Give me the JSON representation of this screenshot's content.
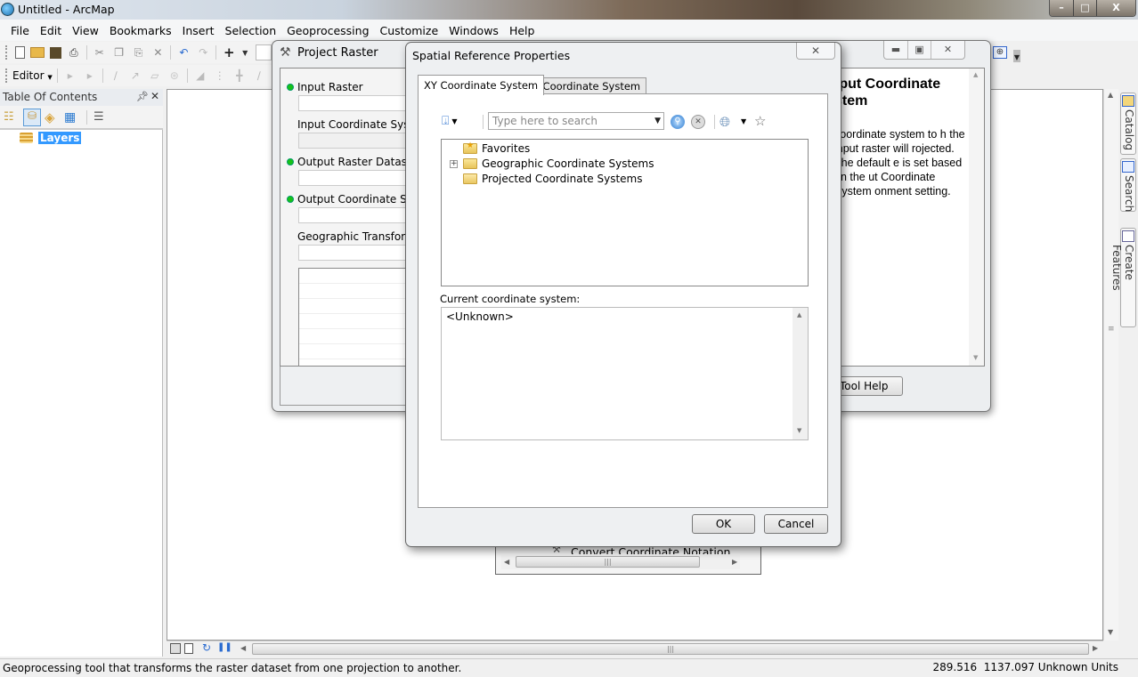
{
  "window": {
    "title": "Untitled - ArcMap",
    "controls": {
      "minimize": "–",
      "maximize": "□",
      "close": "X"
    }
  },
  "menubar": {
    "items": [
      "File",
      "Edit",
      "View",
      "Bookmarks",
      "Insert",
      "Selection",
      "Geoprocessing",
      "Customize",
      "Windows",
      "Help"
    ]
  },
  "toolbar": {
    "editor_label": "Editor"
  },
  "toc": {
    "title": "Table Of Contents",
    "pin": "⌂",
    "close": "✕",
    "root_layer": "Layers"
  },
  "right_dock": {
    "tabs": [
      "Catalog",
      "Search",
      "Create Features"
    ]
  },
  "status_bar": {
    "message": "Geoprocessing tool that transforms the raster dataset from one projection to another.",
    "coordinates": "289.516  1137.097 Unknown Units"
  },
  "project_raster": {
    "title": "Project Raster",
    "params": [
      {
        "label": "Input Raster",
        "required": true,
        "value": ""
      },
      {
        "label": "Input Coordinate System",
        "required": false,
        "value": ""
      },
      {
        "label": "Output Raster Dataset",
        "required": true,
        "value": ""
      },
      {
        "label": "Output Coordinate System",
        "required": true,
        "value": ""
      },
      {
        "label": "Geographic Transformation",
        "required": false,
        "value": ""
      }
    ],
    "help": {
      "title": "Output Coordinate System",
      "title_visible": "tput Coordinate stem",
      "body_visible": "coordinate system to h the input raster will rojected. The default e is set based on the ut Coordinate System onment setting."
    },
    "tool_help_button": "Tool Help"
  },
  "convert_window": {
    "item": "Convert Coordinate Notation"
  },
  "spatial_ref": {
    "title": "Spatial Reference Properties",
    "close": "X",
    "tabs": [
      {
        "label": "XY Coordinate System",
        "active": true
      },
      {
        "label": "Z Coordinate System",
        "active": false
      }
    ],
    "search_placeholder": "Type here to search",
    "tree": [
      {
        "label": "Favorites",
        "icon": "favorites-folder-icon",
        "expandable": false
      },
      {
        "label": "Geographic Coordinate Systems",
        "icon": "folder-icon",
        "expandable": true
      },
      {
        "label": "Projected Coordinate Systems",
        "icon": "folder-open-icon",
        "expandable": false
      }
    ],
    "current_label": "Current coordinate system:",
    "current_value": "<Unknown>",
    "ok": "OK",
    "cancel": "Cancel"
  }
}
